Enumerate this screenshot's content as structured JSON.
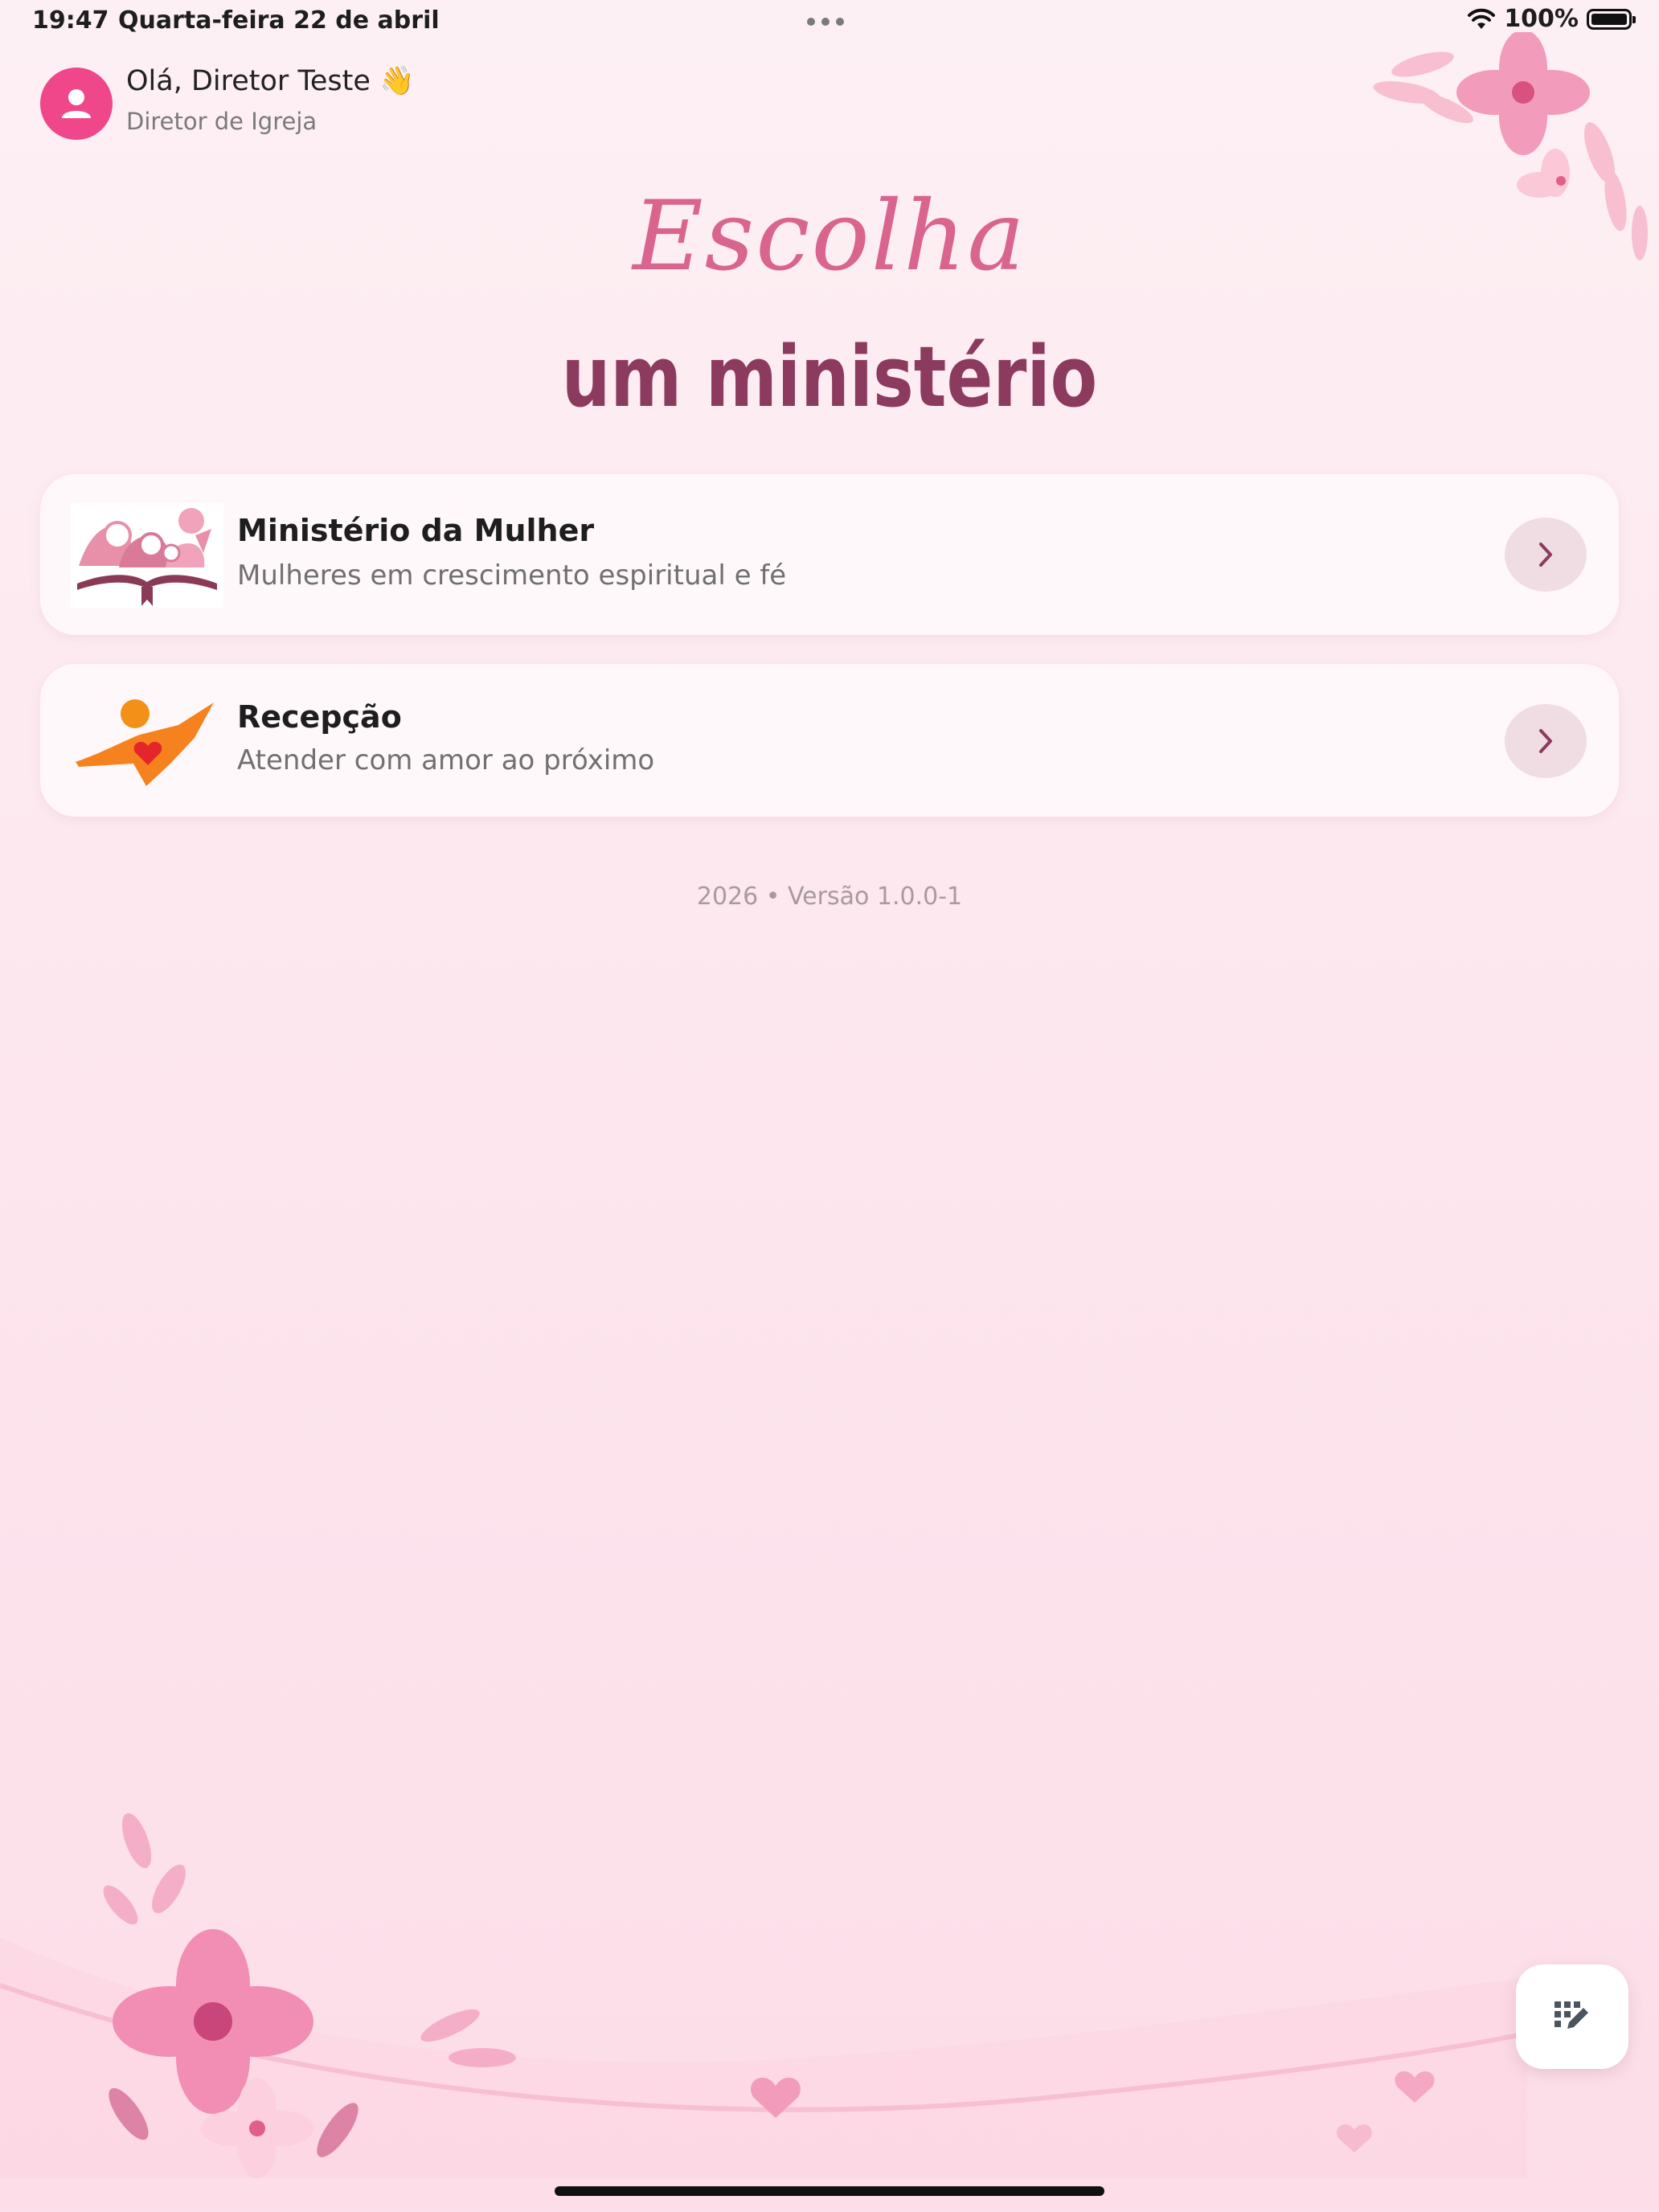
{
  "status_bar": {
    "time": "19:47",
    "date": "Quarta-feira 22 de abril",
    "battery": "100%"
  },
  "header": {
    "greeting": "Olá, Diretor Teste 👋",
    "role": "Diretor de Igreja"
  },
  "title": {
    "script": "Escolha",
    "main": "um ministério"
  },
  "ministries": [
    {
      "title": "Ministério da Mulher",
      "subtitle": "Mulheres em crescimento espiritual e fé",
      "icon": "women-ministry-logo"
    },
    {
      "title": "Recepção",
      "subtitle": "Atender com amor ao próximo",
      "icon": "reception-logo"
    }
  ],
  "footer": {
    "version": "2026 • Versão 1.0.0-1"
  },
  "colors": {
    "accent": "#f0478a",
    "title_script": "#d9658f",
    "title_main": "#8c3a5e",
    "chevron_bg": "#efdde3"
  }
}
